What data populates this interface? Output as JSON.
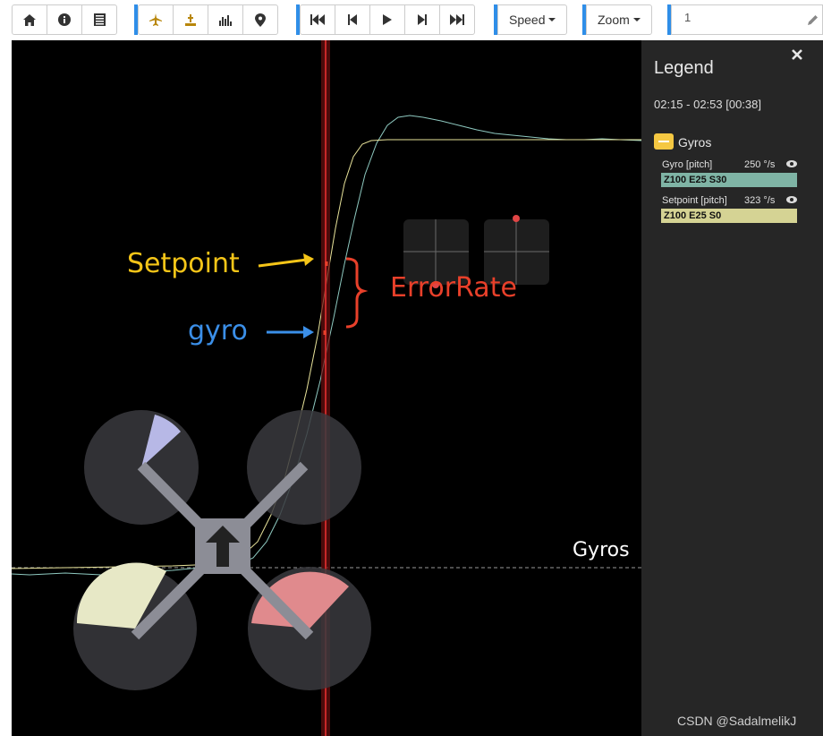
{
  "toolbar": {
    "nav_icons": [
      "home-icon",
      "info-icon",
      "list-icon"
    ],
    "view_icons": [
      "craft-icon",
      "sticks-icon",
      "analyser-icon",
      "map-icon"
    ],
    "playback_icons": [
      "skip-start-icon",
      "step-back-icon",
      "play-icon",
      "step-forward-icon",
      "skip-end-icon"
    ],
    "speed_label": "Speed",
    "zoom_label": "Zoom",
    "frame_value": "1"
  },
  "graph": {
    "annotations": {
      "setpoint": "Setpoint",
      "gyro": "gyro",
      "error_rate": "ErrorRate"
    },
    "group_label": "Gyros",
    "colors": {
      "setpoint_trace": "#e8e39a",
      "gyro_trace": "#8ec9c0",
      "cursor": "#c62828",
      "annotation_setpoint": "#f5c518",
      "annotation_gyro": "#3b8fe8",
      "annotation_error": "#e8402a"
    }
  },
  "legend": {
    "title": "Legend",
    "close_icon": "close-icon",
    "time_range": "02:15 - 02:53 [00:38]",
    "group_name": "Gyros",
    "fields": [
      {
        "label": "Gyro [pitch]",
        "value": "250 °/s",
        "chip": "Z100 E25 S30",
        "color": "#7fb4a5"
      },
      {
        "label": "Setpoint [pitch]",
        "value": "323 °/s",
        "chip": "Z100 E25 S0",
        "color": "#d5d394"
      }
    ]
  },
  "watermark": "CSDN @SadalmelikJ"
}
